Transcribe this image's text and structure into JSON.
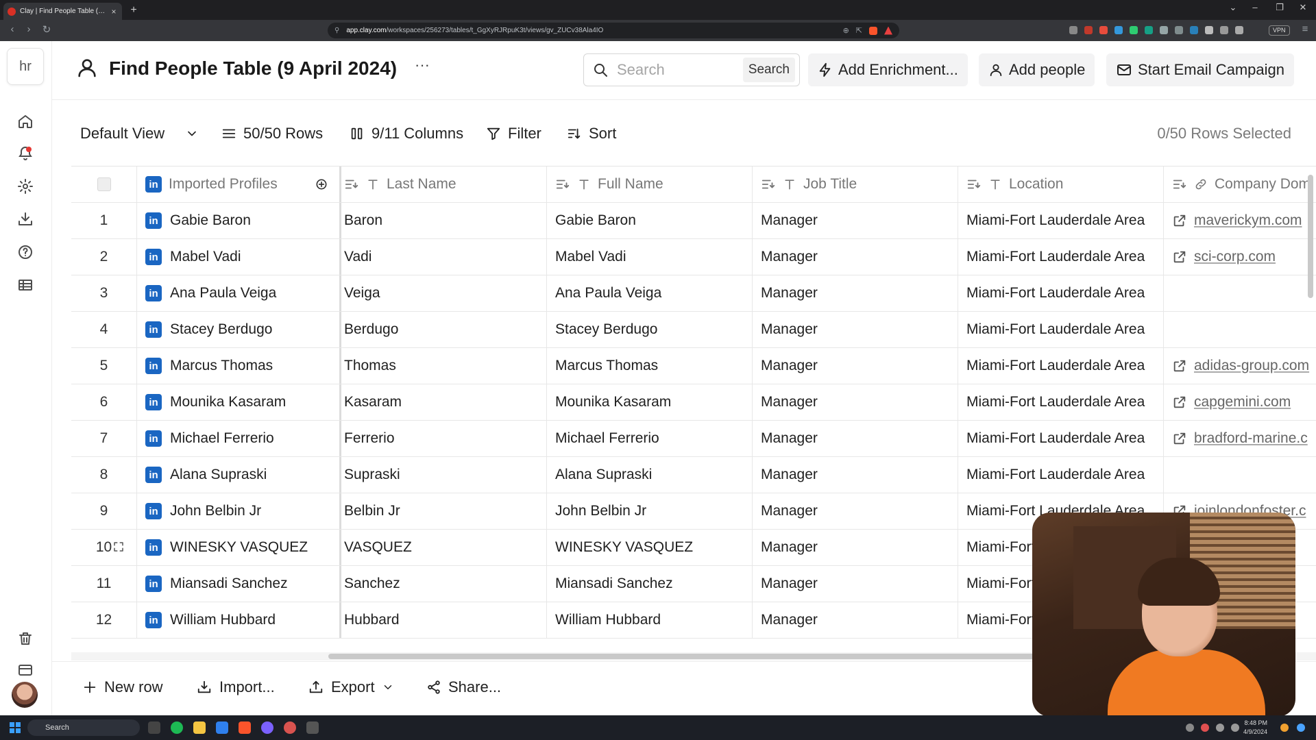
{
  "browser": {
    "tab_title": "Clay | Find People Table (9 April...",
    "url_domain": "app.clay.com",
    "url_path": "/workspaces/256273/tables/t_GgXyRJRpuK3t/views/gv_ZUCv38Ala4IO",
    "vpn_label": "VPN"
  },
  "sidebar": {
    "workspace_initials": "hr"
  },
  "header": {
    "title": "Find People Table (9 April 2024)",
    "more_label": "···",
    "search_placeholder": "Search",
    "search_button": "Search",
    "add_enrichment": "Add Enrichment...",
    "add_people": "Add people",
    "start_email_campaign": "Start Email Campaign"
  },
  "toolbar": {
    "view": "Default View",
    "rows": "50/50 Rows",
    "columns": "9/11 Columns",
    "filter": "Filter",
    "sort": "Sort",
    "rows_selected": "0/50 Rows Selected"
  },
  "table": {
    "columns": [
      "Imported Profiles",
      "Last Name",
      "Full Name",
      "Job Title",
      "Location",
      "Company Dom"
    ],
    "rows": [
      {
        "n": "1",
        "profile": "Gabie Baron",
        "last": "Baron",
        "full": "Gabie Baron",
        "job": "Manager",
        "loc": "Miami-Fort Lauderdale Area",
        "domain": "maverickym.com"
      },
      {
        "n": "2",
        "profile": "Mabel Vadi",
        "last": "Vadi",
        "full": "Mabel Vadi",
        "job": "Manager",
        "loc": "Miami-Fort Lauderdale Area",
        "domain": "sci-corp.com"
      },
      {
        "n": "3",
        "profile": "Ana Paula Veiga",
        "last": "Veiga",
        "full": "Ana Paula Veiga",
        "job": "Manager",
        "loc": "Miami-Fort Lauderdale Area",
        "domain": ""
      },
      {
        "n": "4",
        "profile": "Stacey Berdugo",
        "last": "Berdugo",
        "full": "Stacey Berdugo",
        "job": "Manager",
        "loc": "Miami-Fort Lauderdale Area",
        "domain": ""
      },
      {
        "n": "5",
        "profile": "Marcus Thomas",
        "last": "Thomas",
        "full": "Marcus Thomas",
        "job": "Manager",
        "loc": "Miami-Fort Lauderdale Area",
        "domain": "adidas-group.com"
      },
      {
        "n": "6",
        "profile": "Mounika Kasaram",
        "last": "Kasaram",
        "full": "Mounika Kasaram",
        "job": "Manager",
        "loc": "Miami-Fort Lauderdale Area",
        "domain": "capgemini.com"
      },
      {
        "n": "7",
        "profile": "Michael Ferrerio",
        "last": "Ferrerio",
        "full": "Michael Ferrerio",
        "job": "Manager",
        "loc": "Miami-Fort Lauderdale Area",
        "domain": "bradford-marine.c"
      },
      {
        "n": "8",
        "profile": "Alana Supraski",
        "last": "Supraski",
        "full": "Alana Supraski",
        "job": "Manager",
        "loc": "Miami-Fort Lauderdale Area",
        "domain": ""
      },
      {
        "n": "9",
        "profile": "John Belbin Jr",
        "last": "Belbin Jr",
        "full": "John Belbin Jr",
        "job": "Manager",
        "loc": "Miami-Fort Lauderdale Area",
        "domain": "joinlondonfoster.c"
      },
      {
        "n": "10",
        "profile": "WINESKY VASQUEZ",
        "last": "VASQUEZ",
        "full": "WINESKY VASQUEZ",
        "job": "Manager",
        "loc": "Miami-Fort",
        "domain": ""
      },
      {
        "n": "11",
        "profile": "Miansadi Sanchez",
        "last": "Sanchez",
        "full": "Miansadi Sanchez",
        "job": "Manager",
        "loc": "Miami-Fort",
        "domain": ""
      },
      {
        "n": "12",
        "profile": "William Hubbard",
        "last": "Hubbard",
        "full": "William Hubbard",
        "job": "Manager",
        "loc": "Miami-Fort",
        "domain": ""
      }
    ]
  },
  "footer": {
    "new_row": "New row",
    "import": "Import...",
    "export": "Export",
    "share": "Share..."
  },
  "taskbar": {
    "search": "Search",
    "time": "8:48 PM",
    "date": "4/9/2024"
  },
  "colors": {
    "linkedin": "#1a66c2",
    "accent_text": "#222222"
  }
}
